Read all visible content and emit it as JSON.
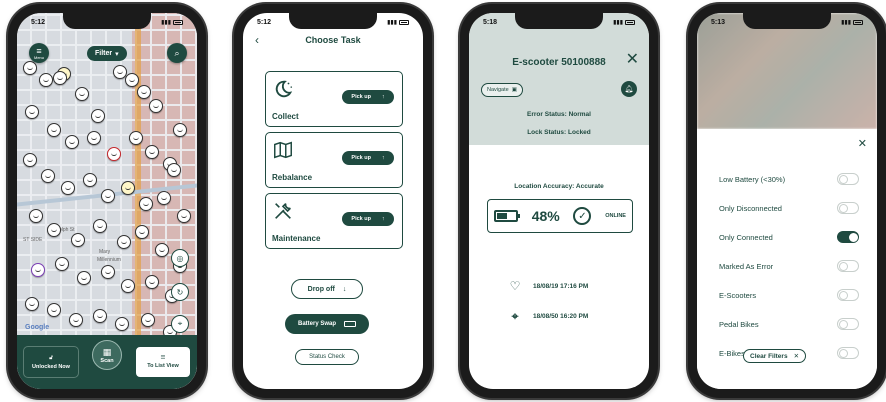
{
  "status_times": {
    "map": "5:12",
    "task": "5:12",
    "detail": "5:18",
    "filter": "5:13"
  },
  "map_screen": {
    "menu_label": "Menu",
    "filter_label": "Filter",
    "google_label": "Google",
    "map_labels": [
      "Randolph St",
      "Mary",
      "Millennium",
      "ST SIDE"
    ],
    "unlocked_label": "Unlocked Now",
    "scan_label": "Scan",
    "list_view_label": "To List View"
  },
  "task_screen": {
    "title": "Choose Task",
    "tasks": [
      {
        "name": "Collect",
        "button": "Pick up",
        "icon": "moon-stars-icon"
      },
      {
        "name": "Rebalance",
        "button": "Pick up",
        "icon": "map-icon"
      },
      {
        "name": "Maintenance",
        "button": "Pick up",
        "icon": "tools-icon"
      }
    ],
    "drop_off": "Drop off",
    "battery_swap": "Battery Swap",
    "status_check": "Status Check"
  },
  "detail_screen": {
    "title": "E-scooter 50100888",
    "navigate": "Navigate",
    "error_status": "Error Status: Normal",
    "lock_status": "Lock Status: Locked",
    "accuracy": "Location Accuracy: Accurate",
    "battery_percent": "48%",
    "battery_level": 0.48,
    "online": "ONLINE",
    "events": [
      {
        "icon": "heart-icon",
        "text": "18/08/19 17:16 PM"
      },
      {
        "icon": "crosshair-icon",
        "text": "18/08/50 16:20 PM"
      }
    ]
  },
  "filter_screen": {
    "filters": [
      {
        "label": "Low Battery (<30%)",
        "on": false
      },
      {
        "label": "Only Disconnected",
        "on": false
      },
      {
        "label": "Only Connected",
        "on": true
      },
      {
        "label": "Marked As Error",
        "on": false
      },
      {
        "label": "E-Scooters",
        "on": false
      },
      {
        "label": "Pedal Bikes",
        "on": false
      },
      {
        "label": "E-Bikes",
        "on": false
      }
    ],
    "clear": "Clear Filters"
  },
  "colors": {
    "brand": "#1f4a40",
    "map_background": "#d7dbe0",
    "detail_header": "#d2dcd9"
  }
}
